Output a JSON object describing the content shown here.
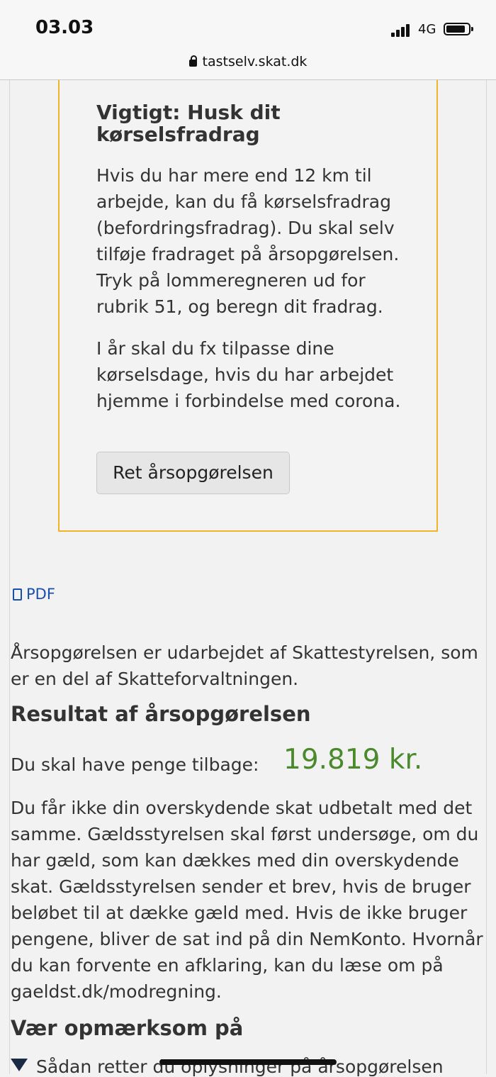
{
  "status_bar": {
    "time": "03.03",
    "network": "4G"
  },
  "address_bar": {
    "url": "tastselv.skat.dk"
  },
  "notice": {
    "title": "Vigtigt: Husk dit kørselsfradrag",
    "paragraph1": "Hvis du har mere end 12 km til arbejde, kan du få kørselsfradrag (befordringsfradrag). Du skal selv tilføje fradraget på årsopgørelsen. Tryk på lommeregneren ud for rubrik 51, og beregn dit fradrag.",
    "paragraph2": "I år skal du fx tilpasse dine kørselsdage, hvis du har arbejdet hjemme i forbindelse med corona.",
    "button_label": "Ret årsopgørelsen",
    "accent_color": "#f0b429"
  },
  "pdf_link": {
    "label": "PDF",
    "icon": "pdf-file-icon"
  },
  "intro_text": "Årsopgørelsen er udarbejdet af Skattestyrelsen, som er en del af Skatteforvaltningen.",
  "result": {
    "heading": "Resultat af årsopgørelsen",
    "refund_label": "Du skal have penge tilbage:",
    "refund_amount": "19.819 kr.",
    "amount_color": "#4a8a2c",
    "body": "Du får ikke din overskydende skat udbetalt med det samme. Gældsstyrelsen skal først undersøge, om du har gæld, som kan dækkes med din overskydende skat. Gældsstyrelsen sender et brev, hvis de bruger beløbet til at dække gæld med. Hvis de ikke bruger pengene, bliver de sat ind på din NemKonto. Hvornår du kan forvente en afklaring, kan du læse om på gaeldst.dk/modregning."
  },
  "aware": {
    "heading": "Vær opmærksom på",
    "disclosure_label": "Sådan retter du oplysninger på årsopgørelsen"
  }
}
